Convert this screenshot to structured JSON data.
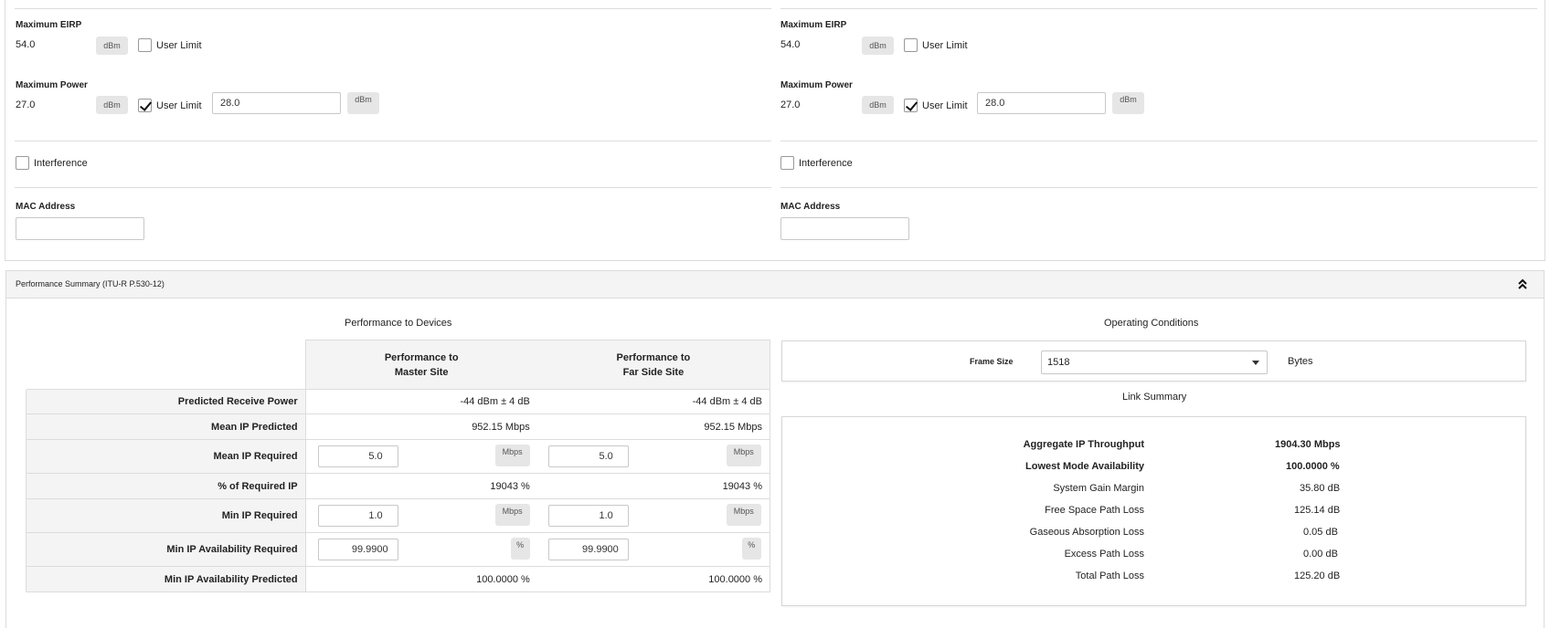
{
  "left_device": {
    "max_eirp_label": "Maximum EIRP",
    "max_eirp_value": "54.0",
    "max_eirp_unit": "dBm",
    "max_eirp_user_limit_label": "User Limit",
    "max_power_label": "Maximum Power",
    "max_power_value": "27.0",
    "max_power_unit": "dBm",
    "max_power_user_limit_label": "User Limit",
    "max_power_user_limit_value": "28.0",
    "max_power_user_limit_unit": "dBm",
    "interference_label": "Interference",
    "mac_label": "MAC Address",
    "mac_value": ""
  },
  "right_device": {
    "max_eirp_label": "Maximum EIRP",
    "max_eirp_value": "54.0",
    "max_eirp_unit": "dBm",
    "max_eirp_user_limit_label": "User Limit",
    "max_power_label": "Maximum Power",
    "max_power_value": "27.0",
    "max_power_unit": "dBm",
    "max_power_user_limit_label": "User Limit",
    "max_power_user_limit_value": "28.0",
    "max_power_user_limit_unit": "dBm",
    "interference_label": "Interference",
    "mac_label": "MAC Address",
    "mac_value": ""
  },
  "performance_summary": {
    "header": "Performance Summary (ITU-R P.530-12)",
    "devices_title": "Performance to Devices",
    "col_master_line1": "Performance to",
    "col_master_line2": "Master Site",
    "col_far_line1": "Performance to",
    "col_far_line2": "Far Side Site",
    "rows": {
      "predicted_receive_power": {
        "label": "Predicted Receive Power",
        "master": "-44 dBm ± 4 dB",
        "far": "-44 dBm ± 4 dB"
      },
      "mean_ip_predicted": {
        "label": "Mean IP Predicted",
        "master": "952.15 Mbps",
        "far": "952.15 Mbps"
      },
      "mean_ip_required": {
        "label": "Mean IP Required",
        "master": "5.0",
        "far": "5.0",
        "unit": "Mbps"
      },
      "pct_required_ip": {
        "label": "% of Required IP",
        "master": "19043 %",
        "far": "19043 %"
      },
      "min_ip_required": {
        "label": "Min IP Required",
        "master": "1.0",
        "far": "1.0",
        "unit": "Mbps"
      },
      "min_ip_avail_required": {
        "label": "Min IP Availability Required",
        "master": "99.9900",
        "far": "99.9900",
        "unit": "%"
      },
      "min_ip_avail_predicted": {
        "label": "Min IP Availability Predicted",
        "master": "100.0000 %",
        "far": "100.0000 %"
      }
    },
    "operating_title": "Operating Conditions",
    "frame_size_label": "Frame Size",
    "frame_size_value": "1518",
    "frame_size_unit": "Bytes",
    "link_summary_title": "Link Summary",
    "link_summary": {
      "aggregate_label": "Aggregate IP Throughput",
      "aggregate_value": "1904.30 Mbps",
      "lowest_label": "Lowest Mode Availability",
      "lowest_value": "100.0000 %",
      "sgm_label": "System Gain Margin",
      "sgm_value": "35.80 dB",
      "fspl_label": "Free Space Path Loss",
      "fspl_value": "125.14 dB",
      "gas_label": "Gaseous Absorption Loss",
      "gas_value": "0.05 dB",
      "excess_label": "Excess Path Loss",
      "excess_value": "0.00 dB",
      "total_label": "Total Path Loss",
      "total_value": "125.20 dB"
    }
  }
}
